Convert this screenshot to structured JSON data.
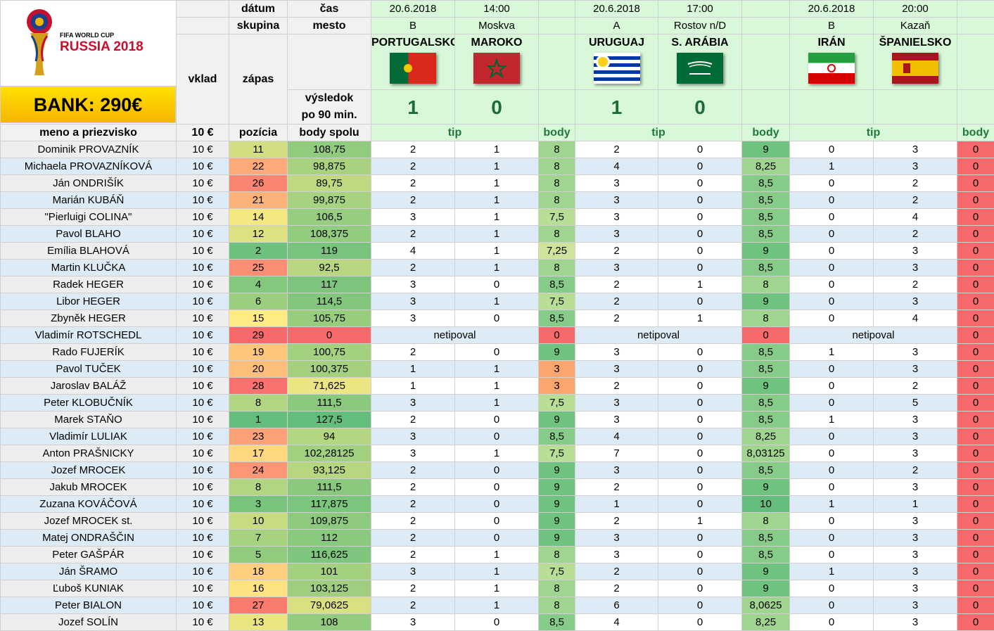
{
  "logo": {
    "line1": "FIFA WORLD CUP",
    "line2": "RUSSIA 2018"
  },
  "bank": "BANK: 290€",
  "labels": {
    "datum": "dátum",
    "cas": "čas",
    "skupina": "skupina",
    "mesto": "mesto",
    "vklad": "vklad",
    "zapas": "zápas",
    "vysledok1": "výsledok",
    "vysledok2": "po 90 min.",
    "meno": "meno a priezvisko",
    "vklad_val": "10 €",
    "pozicia": "pozícia",
    "body_spolu": "body spolu",
    "tip": "tip",
    "body": "body"
  },
  "matches": [
    {
      "date": "20.6.2018",
      "time": "14:00",
      "group": "B",
      "city": "Moskva",
      "home": "PORTUGALSKO",
      "away": "MAROKO",
      "home_score": "1",
      "away_score": "0",
      "home_flag": "portugal-flag-icon",
      "away_flag": "morocco-flag-icon"
    },
    {
      "date": "20.6.2018",
      "time": "17:00",
      "group": "A",
      "city": "Rostov n/D",
      "home": "URUGUAJ",
      "away": "S. ARÁBIA",
      "home_score": "1",
      "away_score": "0",
      "home_flag": "uruguay-flag-icon",
      "away_flag": "saudi-arabia-flag-icon"
    },
    {
      "date": "20.6.2018",
      "time": "20:00",
      "group": "B",
      "city": "Kazaň",
      "home": "IRÁN",
      "away": "ŠPANIELSKO",
      "home_score": "",
      "away_score": "",
      "home_flag": "iran-flag-icon",
      "away_flag": "spain-flag-icon"
    }
  ],
  "not_tipped": "netipoval",
  "colors": {
    "header_green": "#d9f7d9",
    "tip_text": "#1f7a3a",
    "score_text": "#1f6b35",
    "bank_yellow": "#ffe100",
    "row_blue": "#dcebf5"
  },
  "rows": [
    {
      "name": "Dominik PROVAZNÍK",
      "vklad": "10 €",
      "poz": "11",
      "total": "108,75",
      "m1": [
        "2",
        "1",
        "8"
      ],
      "m2": [
        "2",
        "0",
        "9"
      ],
      "m3": [
        "0",
        "3",
        "0"
      ]
    },
    {
      "name": "Michaela PROVAZNÍKOVÁ",
      "vklad": "10 €",
      "poz": "22",
      "total": "98,875",
      "m1": [
        "2",
        "1",
        "8"
      ],
      "m2": [
        "4",
        "0",
        "8,25"
      ],
      "m3": [
        "1",
        "3",
        "0"
      ]
    },
    {
      "name": "Ján ONDRIŠÍK",
      "vklad": "10 €",
      "poz": "26",
      "total": "89,75",
      "m1": [
        "2",
        "1",
        "8"
      ],
      "m2": [
        "3",
        "0",
        "8,5"
      ],
      "m3": [
        "0",
        "2",
        "0"
      ]
    },
    {
      "name": "Marián KUBÁŇ",
      "vklad": "10 €",
      "poz": "21",
      "total": "99,875",
      "m1": [
        "2",
        "1",
        "8"
      ],
      "m2": [
        "3",
        "0",
        "8,5"
      ],
      "m3": [
        "0",
        "2",
        "0"
      ]
    },
    {
      "name": "\"Pierluigi COLINA\"",
      "vklad": "10 €",
      "poz": "14",
      "total": "106,5",
      "m1": [
        "3",
        "1",
        "7,5"
      ],
      "m2": [
        "3",
        "0",
        "8,5"
      ],
      "m3": [
        "0",
        "4",
        "0"
      ]
    },
    {
      "name": "Pavol BLAHO",
      "vklad": "10 €",
      "poz": "12",
      "total": "108,375",
      "m1": [
        "2",
        "1",
        "8"
      ],
      "m2": [
        "3",
        "0",
        "8,5"
      ],
      "m3": [
        "0",
        "2",
        "0"
      ]
    },
    {
      "name": "Emília BLAHOVÁ",
      "vklad": "10 €",
      "poz": "2",
      "total": "119",
      "m1": [
        "4",
        "1",
        "7,25"
      ],
      "m2": [
        "2",
        "0",
        "9"
      ],
      "m3": [
        "0",
        "3",
        "0"
      ]
    },
    {
      "name": "Martin KLUČKA",
      "vklad": "10 €",
      "poz": "25",
      "total": "92,5",
      "m1": [
        "2",
        "1",
        "8"
      ],
      "m2": [
        "3",
        "0",
        "8,5"
      ],
      "m3": [
        "0",
        "3",
        "0"
      ]
    },
    {
      "name": "Radek HEGER",
      "vklad": "10 €",
      "poz": "4",
      "total": "117",
      "m1": [
        "3",
        "0",
        "8,5"
      ],
      "m2": [
        "2",
        "1",
        "8"
      ],
      "m3": [
        "0",
        "2",
        "0"
      ]
    },
    {
      "name": "Libor HEGER",
      "vklad": "10 €",
      "poz": "6",
      "total": "114,5",
      "m1": [
        "3",
        "1",
        "7,5"
      ],
      "m2": [
        "2",
        "0",
        "9"
      ],
      "m3": [
        "0",
        "3",
        "0"
      ]
    },
    {
      "name": "Zbyněk HEGER",
      "vklad": "10 €",
      "poz": "15",
      "total": "105,75",
      "m1": [
        "3",
        "0",
        "8,5"
      ],
      "m2": [
        "2",
        "1",
        "8"
      ],
      "m3": [
        "0",
        "4",
        "0"
      ]
    },
    {
      "name": "Vladimír ROTSCHEDL",
      "vklad": "10 €",
      "poz": "29",
      "total": "0",
      "nt": true,
      "m1": [
        "",
        "",
        "0"
      ],
      "m2": [
        "",
        "",
        "0"
      ],
      "m3": [
        "",
        "",
        "0"
      ]
    },
    {
      "name": "Rado FUJERÍK",
      "vklad": "10 €",
      "poz": "19",
      "total": "100,75",
      "m1": [
        "2",
        "0",
        "9"
      ],
      "m2": [
        "3",
        "0",
        "8,5"
      ],
      "m3": [
        "1",
        "3",
        "0"
      ]
    },
    {
      "name": "Pavol TUČEK",
      "vklad": "10 €",
      "poz": "20",
      "total": "100,375",
      "m1": [
        "1",
        "1",
        "3"
      ],
      "m2": [
        "3",
        "0",
        "8,5"
      ],
      "m3": [
        "0",
        "3",
        "0"
      ]
    },
    {
      "name": "Jaroslav BALÁŽ",
      "vklad": "10 €",
      "poz": "28",
      "total": "71,625",
      "m1": [
        "1",
        "1",
        "3"
      ],
      "m2": [
        "2",
        "0",
        "9"
      ],
      "m3": [
        "0",
        "2",
        "0"
      ]
    },
    {
      "name": "Peter KLOBUČNÍK",
      "vklad": "10 €",
      "poz": "8",
      "total": "111,5",
      "m1": [
        "3",
        "1",
        "7,5"
      ],
      "m2": [
        "3",
        "0",
        "8,5"
      ],
      "m3": [
        "0",
        "5",
        "0"
      ]
    },
    {
      "name": "Marek STAŇO",
      "vklad": "10 €",
      "poz": "1",
      "total": "127,5",
      "m1": [
        "2",
        "0",
        "9"
      ],
      "m2": [
        "3",
        "0",
        "8,5"
      ],
      "m3": [
        "1",
        "3",
        "0"
      ]
    },
    {
      "name": "Vladimír LULIAK",
      "vklad": "10 €",
      "poz": "23",
      "total": "94",
      "m1": [
        "3",
        "0",
        "8,5"
      ],
      "m2": [
        "4",
        "0",
        "8,25"
      ],
      "m3": [
        "0",
        "3",
        "0"
      ]
    },
    {
      "name": "Anton PRAŠNICKY",
      "vklad": "10 €",
      "poz": "17",
      "total": "102,28125",
      "m1": [
        "3",
        "1",
        "7,5"
      ],
      "m2": [
        "7",
        "0",
        "8,03125"
      ],
      "m3": [
        "0",
        "3",
        "0"
      ]
    },
    {
      "name": "Jozef MROCEK",
      "vklad": "10 €",
      "poz": "24",
      "total": "93,125",
      "m1": [
        "2",
        "0",
        "9"
      ],
      "m2": [
        "3",
        "0",
        "8,5"
      ],
      "m3": [
        "0",
        "2",
        "0"
      ]
    },
    {
      "name": "Jakub MROCEK",
      "vklad": "10 €",
      "poz": "8",
      "total": "111,5",
      "m1": [
        "2",
        "0",
        "9"
      ],
      "m2": [
        "2",
        "0",
        "9"
      ],
      "m3": [
        "0",
        "3",
        "0"
      ]
    },
    {
      "name": "Zuzana KOVÁČOVÁ",
      "vklad": "10 €",
      "poz": "3",
      "total": "117,875",
      "m1": [
        "2",
        "0",
        "9"
      ],
      "m2": [
        "1",
        "0",
        "10"
      ],
      "m3": [
        "1",
        "1",
        "0"
      ]
    },
    {
      "name": "Jozef MROCEK st.",
      "vklad": "10 €",
      "poz": "10",
      "total": "109,875",
      "m1": [
        "2",
        "0",
        "9"
      ],
      "m2": [
        "2",
        "1",
        "8"
      ],
      "m3": [
        "0",
        "3",
        "0"
      ]
    },
    {
      "name": "Matej ONDRAŠČIN",
      "vklad": "10 €",
      "poz": "7",
      "total": "112",
      "m1": [
        "2",
        "0",
        "9"
      ],
      "m2": [
        "3",
        "0",
        "8,5"
      ],
      "m3": [
        "0",
        "3",
        "0"
      ]
    },
    {
      "name": "Peter GAŠPÁR",
      "vklad": "10 €",
      "poz": "5",
      "total": "116,625",
      "m1": [
        "2",
        "1",
        "8"
      ],
      "m2": [
        "3",
        "0",
        "8,5"
      ],
      "m3": [
        "0",
        "3",
        "0"
      ]
    },
    {
      "name": "Ján ŠRAMO",
      "vklad": "10 €",
      "poz": "18",
      "total": "101",
      "m1": [
        "3",
        "1",
        "7,5"
      ],
      "m2": [
        "2",
        "0",
        "9"
      ],
      "m3": [
        "1",
        "3",
        "0"
      ]
    },
    {
      "name": "Ľuboš KUNIAK",
      "vklad": "10 €",
      "poz": "16",
      "total": "103,125",
      "m1": [
        "2",
        "1",
        "8"
      ],
      "m2": [
        "2",
        "0",
        "9"
      ],
      "m3": [
        "0",
        "3",
        "0"
      ]
    },
    {
      "name": "Peter BIALON",
      "vklad": "10 €",
      "poz": "27",
      "total": "79,0625",
      "m1": [
        "2",
        "1",
        "8"
      ],
      "m2": [
        "6",
        "0",
        "8,0625"
      ],
      "m3": [
        "0",
        "3",
        "0"
      ]
    },
    {
      "name": "Jozef SOLÍN",
      "vklad": "10 €",
      "poz": "13",
      "total": "108",
      "m1": [
        "3",
        "0",
        "8,5"
      ],
      "m2": [
        "4",
        "0",
        "8,25"
      ],
      "m3": [
        "0",
        "3",
        "0"
      ]
    }
  ]
}
